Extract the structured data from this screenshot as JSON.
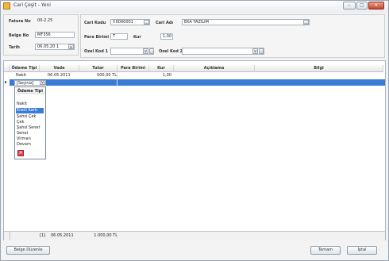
{
  "window": {
    "title": "Cari Çeşit - Yeni",
    "minimize_glyph": "–",
    "maximize_glyph": "▢",
    "close_glyph": "x",
    "icon": "app-icon"
  },
  "header_left": {
    "fis_no_label": "Fatura No",
    "fis_no_value": "00-2.25",
    "belge_no_label": "Belge No",
    "belge_no_value": "MF356",
    "tarih_label": "Tarih",
    "tarih_value": "06.05.20 1",
    "tarih_dd": "v"
  },
  "header_right": {
    "cari_kodu_label": "Cari Kodu",
    "cari_kodu_value": "Y.0000001",
    "cari_adi_label": "Cari Adı",
    "cari_adi_value": "EKA YAZILIM",
    "para_birimi_label": "Para Birimi",
    "para_birimi_value": "T",
    "kur_label": "Kur",
    "kur_value": "1,00",
    "ozel_kod1_label": "Ozel Kod 1",
    "ozel_kod2_label": "Ozel Kod 2",
    "ellipsis": "...",
    "dd": "v"
  },
  "grid": {
    "columns": [
      "Ödeme Tipi",
      "Vade",
      "Tutar",
      "Para Birimi",
      "Kur",
      "Açıklama",
      "Bilgi"
    ],
    "rows": [
      {
        "odeme": "Nakit",
        "vade": "06.05.2011",
        "tutar": "000,00 TL",
        "para": "",
        "kur": "1,00",
        "aciklama": "",
        "bilgi": ""
      }
    ],
    "active_row": {
      "indicator": "▸",
      "odeme": "[Seçiniz]"
    },
    "footer": {
      "count": "[1]",
      "date": "06.05.2011",
      "total": "1.000,00 TL"
    }
  },
  "dropdown": {
    "header": "Ödeme Tipi",
    "items": [
      "Nakit",
      "Kredi Kartı",
      "Şahsi Çek",
      "Çek",
      "Şahsi Senet",
      "Senet",
      "Virman",
      "Devam"
    ],
    "selected_index": 1
  },
  "buttons": {
    "belge_duzenle": "Belge Düzenle",
    "tamam": "Tamam",
    "iptal": "İptal"
  }
}
